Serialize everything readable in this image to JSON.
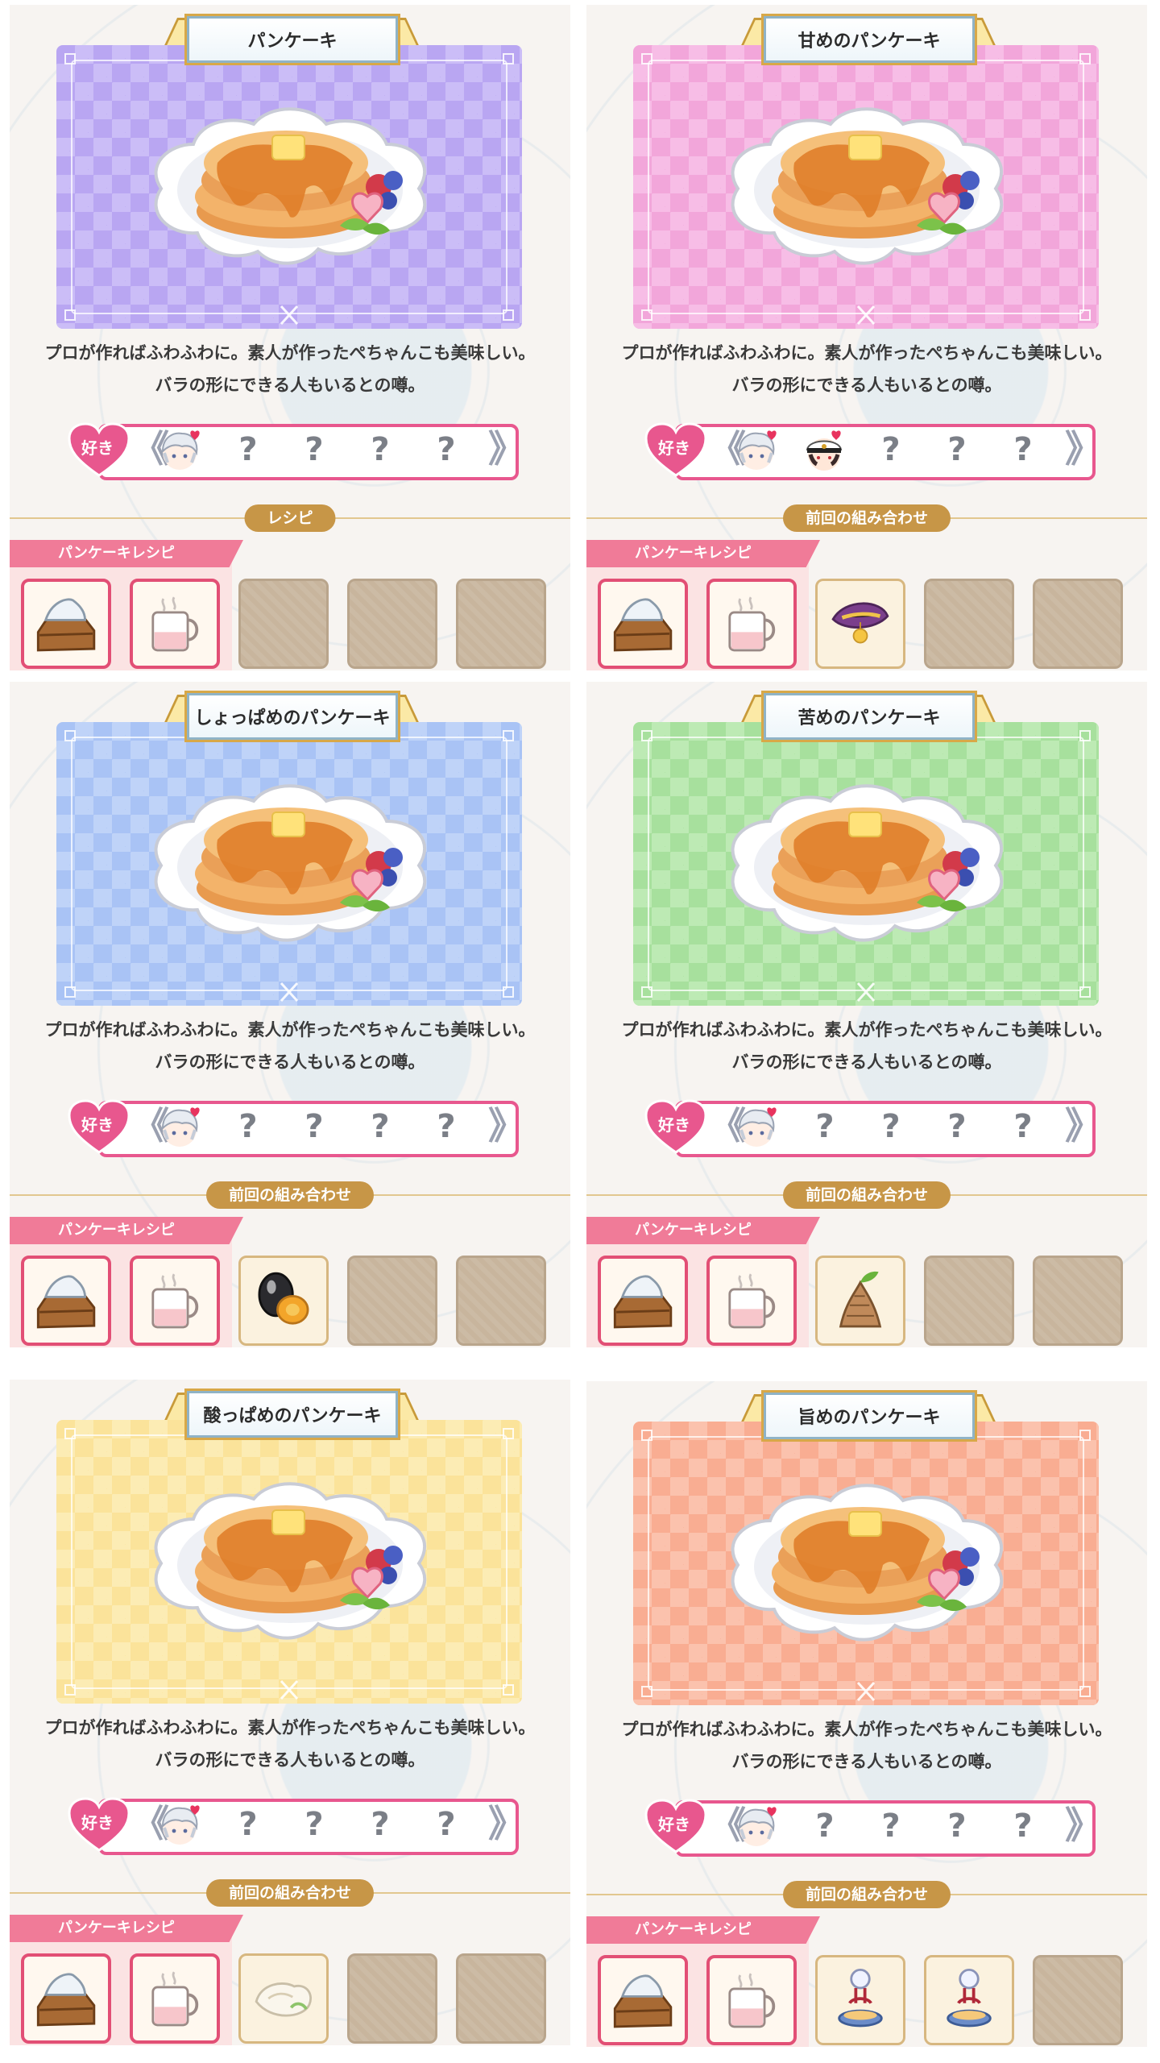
{
  "common": {
    "description_line1": "プロが作ればふわふわに。素人が作ったぺちゃんこも美味しい。",
    "description_line2": "バラの形にできる人もいるとの噂。",
    "likes_label": "好き",
    "unknown_mark": "?",
    "recipe_tag": "パンケーキレシピ"
  },
  "panels": [
    {
      "title": "パンケーキ",
      "card_color": "#b9a6f2",
      "card_color_light": "#cbbdf7",
      "section_label": "レシピ",
      "likes": [
        "avatar-silver",
        "?",
        "?",
        "?",
        "?"
      ],
      "items": [
        {
          "icon": "flour-sack-icon",
          "state": "owned"
        },
        {
          "icon": "milk-mug-icon",
          "state": "owned"
        },
        {
          "icon": "",
          "state": "empty"
        },
        {
          "icon": "",
          "state": "empty"
        },
        {
          "icon": "",
          "state": "empty"
        }
      ]
    },
    {
      "title": "甘めのパンケーキ",
      "card_color": "#f2a6da",
      "card_color_light": "#f7bde6",
      "section_label": "前回の組み合わせ",
      "likes": [
        "avatar-silver",
        "avatar-captain",
        "?",
        "?",
        "?"
      ],
      "items": [
        {
          "icon": "flour-sack-icon",
          "state": "owned"
        },
        {
          "icon": "milk-mug-icon",
          "state": "owned"
        },
        {
          "icon": "sweet-potato-icon",
          "state": "extra"
        },
        {
          "icon": "",
          "state": "empty"
        },
        {
          "icon": "",
          "state": "empty"
        }
      ]
    },
    {
      "title": "しょっぱめのパンケーキ",
      "card_color": "#a9c3f5",
      "card_color_light": "#bfd3f8",
      "section_label": "前回の組み合わせ",
      "likes": [
        "avatar-silver",
        "?",
        "?",
        "?",
        "?"
      ],
      "items": [
        {
          "icon": "flour-sack-icon",
          "state": "owned"
        },
        {
          "icon": "milk-mug-icon",
          "state": "owned"
        },
        {
          "icon": "salted-egg-icon",
          "state": "extra"
        },
        {
          "icon": "",
          "state": "empty"
        },
        {
          "icon": "",
          "state": "empty"
        }
      ]
    },
    {
      "title": "苦めのパンケーキ",
      "card_color": "#a7e09d",
      "card_color_light": "#bdeab4",
      "section_label": "前回の組み合わせ",
      "likes": [
        "avatar-silver",
        "?",
        "?",
        "?",
        "?"
      ],
      "items": [
        {
          "icon": "flour-sack-icon",
          "state": "owned"
        },
        {
          "icon": "milk-mug-icon",
          "state": "owned"
        },
        {
          "icon": "bamboo-shoot-icon",
          "state": "extra"
        },
        {
          "icon": "",
          "state": "empty"
        },
        {
          "icon": "",
          "state": "empty"
        }
      ]
    },
    {
      "title": "酸っぱめのパンケーキ",
      "card_color": "#fbe39a",
      "card_color_light": "#fcecb4",
      "section_label": "前回の組み合わせ",
      "likes": [
        "avatar-silver",
        "?",
        "?",
        "?",
        "?"
      ],
      "items": [
        {
          "icon": "flour-sack-icon",
          "state": "owned"
        },
        {
          "icon": "milk-mug-icon",
          "state": "owned"
        },
        {
          "icon": "chicken-breast-icon",
          "state": "extra"
        },
        {
          "icon": "",
          "state": "empty"
        },
        {
          "icon": "",
          "state": "empty"
        }
      ]
    },
    {
      "title": "旨めのパンケーキ",
      "card_color": "#f9ad92",
      "card_color_light": "#fbc2ad",
      "section_label": "前回の組み合わせ",
      "likes": [
        "avatar-silver",
        "?",
        "?",
        "?",
        "?"
      ],
      "items": [
        {
          "icon": "flour-sack-icon",
          "state": "owned"
        },
        {
          "icon": "milk-mug-icon",
          "state": "owned"
        },
        {
          "icon": "dango-bowl-icon",
          "state": "extra"
        },
        {
          "icon": "dango-bowl-icon",
          "state": "extra"
        },
        {
          "icon": "",
          "state": "empty"
        }
      ]
    }
  ]
}
